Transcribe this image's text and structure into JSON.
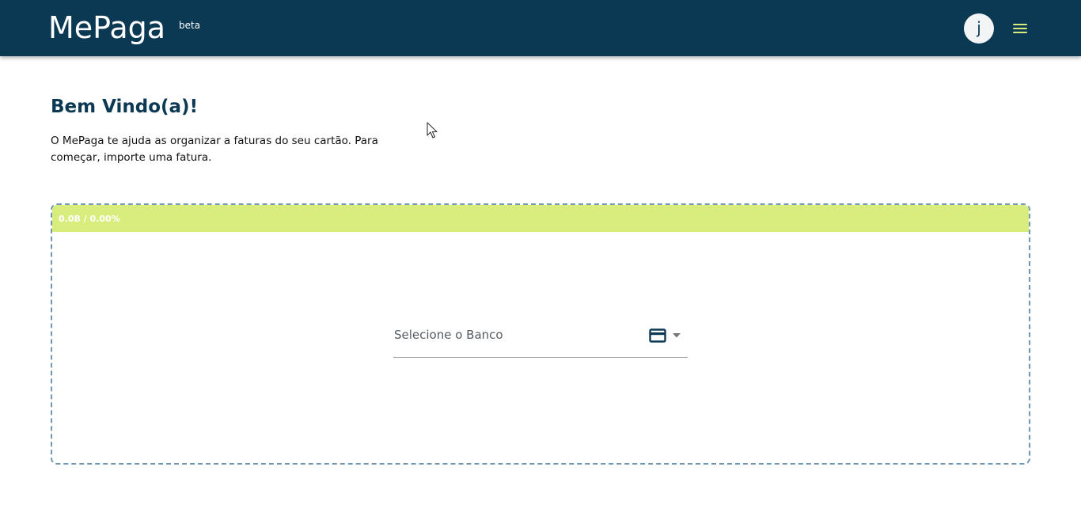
{
  "header": {
    "brand": "MePaga",
    "badge": "beta",
    "avatar_initial": "j",
    "menu_icon": "hamburger-menu-icon"
  },
  "welcome": {
    "title": "Bem Vindo(a)!",
    "text": "O MePaga te ajuda as organizar a faturas do seu cartão. Para começar, importe uma fatura."
  },
  "upload": {
    "progress_text": "0.0B / 0.00%",
    "progress_percent": 0,
    "bank_select": {
      "placeholder": "Selecione o Banco",
      "icon": "credit-card-icon",
      "dropdown_icon": "caret-down-icon"
    }
  },
  "colors": {
    "primary": "#0b3954",
    "accent": "#d8ec7a",
    "dropzone_border": "#6f97b3"
  }
}
